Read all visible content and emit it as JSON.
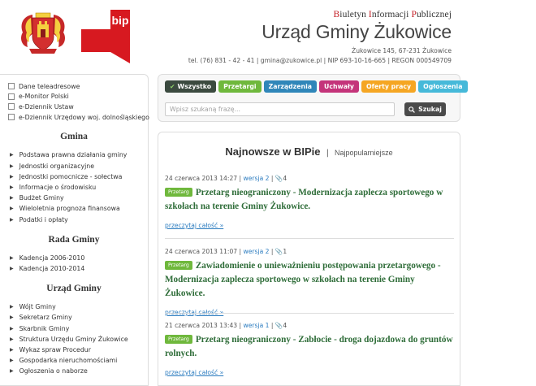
{
  "header": {
    "bip_title": {
      "p1": "B",
      "p2": "iuletyn ",
      "p3": "I",
      "p4": "nformacji ",
      "p5": "P",
      "p6": "ublicznej"
    },
    "office_name": "Urząd Gminy Żukowice",
    "address": "Żukowice 145, 67-231 Żukowice",
    "contact": "tel. (76) 831 - 42 - 41 | gmina@zukowice.pl | NIP 693-10-16-665 | REGON 000549709",
    "bip_logo_text": "bip"
  },
  "sidebar": {
    "top_links": [
      "Dane teleadresowe",
      "e-Monitor Polski",
      "e-Dziennik Ustaw",
      "e-Dziennik Urzędowy woj. dolnośląskiego"
    ],
    "sections": [
      {
        "title": "Gmina",
        "items": [
          "Podstawa prawna działania gminy",
          "Jednostki organizacyjne",
          "Jednostki pomocnicze - sołectwa",
          "Informacje o środowisku",
          "Budżet Gminy",
          "Wieloletnia prognoza finansowa",
          "Podatki i opłaty"
        ]
      },
      {
        "title": "Rada Gminy",
        "items": [
          "Kadencja 2006-2010",
          "Kadencja 2010-2014"
        ]
      },
      {
        "title": "Urząd Gminy",
        "items": [
          "Wójt Gminy",
          "Sekretarz Gminy",
          "Skarbnik Gminy",
          "Struktura Urzędu Gminy Żukowice",
          "Wykaz spraw Procedur",
          "Gospodarka nieruchomościami",
          "Ogłoszenia o naborze"
        ]
      }
    ]
  },
  "tabs": [
    "Wszystko",
    "Przetargi",
    "Zarządzenia",
    "Uchwały",
    "Oferty pracy",
    "Ogłoszenia"
  ],
  "search": {
    "placeholder": "Wpisz szukaną frazę...",
    "button_label": "Szukaj"
  },
  "main": {
    "heading_active": "Najnowsze w BIPie",
    "heading_sep": "|",
    "heading_other": "Najpopularniejsze",
    "articles": [
      {
        "date": "24 czerwca 2013 14:27",
        "version_label": "wersja 2",
        "attachments": "4",
        "badge": "Przetarg",
        "title": "Przetarg nieograniczony - Modernizacja zaplecza sportowego w szkołach na terenie Gminy Żukowice.",
        "read_more": "przeczytaj całość »"
      },
      {
        "date": "24 czerwca 2013 11:07",
        "version_label": "wersja 2",
        "attachments": "1",
        "badge": "Przetarg",
        "title": "Zawiadomienie o unieważnieniu postępowania przetargowego - Modernizacja zaplecza sportowego w szkołach na terenie Gminy Żukowice.",
        "read_more": "przeczytaj całość »"
      },
      {
        "date": "21 czerwca 2013 13:43",
        "version_label": "wersja 1",
        "attachments": "4",
        "badge": "Przetarg",
        "title": "Przetarg nieograniczony - Zabłocie - droga dojazdowa do gruntów rolnych.",
        "read_more": "przeczytaj całość »"
      }
    ]
  },
  "colors": {
    "accent_red": "#c41f25",
    "title_green": "#2f6d39",
    "link_blue": "#2a7bbf"
  }
}
